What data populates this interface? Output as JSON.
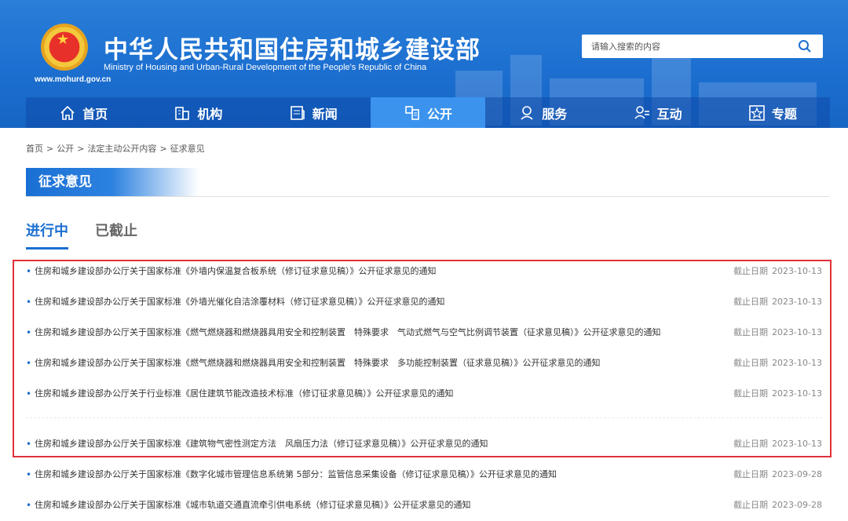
{
  "header": {
    "site_title": "中华人民共和国住房和城乡建设部",
    "site_subtitle": "Ministry of Housing and Urban-Rural Development of the People's Republic of China",
    "site_url": "www.mohurd.gov.cn",
    "logo_icon": "national-emblem-icon"
  },
  "search": {
    "placeholder": "请输入搜索的内容",
    "icon": "search-icon"
  },
  "nav": {
    "items": [
      {
        "label": "首页",
        "icon": "home-icon",
        "active": false
      },
      {
        "label": "机构",
        "icon": "building-icon",
        "active": false
      },
      {
        "label": "新闻",
        "icon": "news-icon",
        "active": false
      },
      {
        "label": "公开",
        "icon": "document-icon",
        "active": true
      },
      {
        "label": "服务",
        "icon": "service-icon",
        "active": false
      },
      {
        "label": "互动",
        "icon": "interaction-icon",
        "active": false
      },
      {
        "label": "专题",
        "icon": "star-icon",
        "active": false
      }
    ]
  },
  "breadcrumb": {
    "items": [
      "首页",
      "公开",
      "法定主动公开内容",
      "征求意见"
    ],
    "separator": ">"
  },
  "section": {
    "title": "征求意见"
  },
  "tabs": {
    "items": [
      {
        "label": "进行中",
        "active": true
      },
      {
        "label": "已截止",
        "active": false
      }
    ]
  },
  "list": {
    "deadline_label": "截止日期",
    "items": [
      {
        "title": "住房和城乡建设部办公厅关于国家标准《外墙内保温复合板系统（修订征求意见稿）》公开征求意见的通知",
        "date": "2023-10-13"
      },
      {
        "title": "住房和城乡建设部办公厅关于国家标准《外墙光催化自洁涂覆材料（修订征求意见稿）》公开征求意见的通知",
        "date": "2023-10-13"
      },
      {
        "title": "住房和城乡建设部办公厅关于国家标准《燃气燃烧器和燃烧器具用安全和控制装置　特殊要求　气动式燃气与空气比例调节装置（征求意见稿）》公开征求意见的通知",
        "date": "2023-10-13"
      },
      {
        "title": "住房和城乡建设部办公厅关于国家标准《燃气燃烧器和燃烧器具用安全和控制装置　特殊要求　多功能控制装置（征求意见稿）》公开征求意见的通知",
        "date": "2023-10-13"
      },
      {
        "title": "住房和城乡建设部办公厅关于行业标准《居住建筑节能改造技术标准（修订征求意见稿）》公开征求意见的通知",
        "date": "2023-10-13"
      },
      {
        "title": "住房和城乡建设部办公厅关于国家标准《建筑物气密性测定方法　风扇压力法（修订征求意见稿）》公开征求意见的通知",
        "date": "2023-10-13"
      },
      {
        "title": "住房和城乡建设部办公厅关于国家标准《数字化城市管理信息系统第 5部分：监管信息采集设备（修订征求意见稿）》公开征求意见的通知",
        "date": "2023-09-28"
      },
      {
        "title": "住房和城乡建设部办公厅关于国家标准《城市轨道交通直流牵引供电系统（修订征求意见稿）》公开征求意见的通知",
        "date": "2023-09-28"
      }
    ]
  },
  "colors": {
    "brand_blue": "#1c6fd0",
    "active_nav": "#3b93ee",
    "highlight_border": "#e0313a"
  }
}
